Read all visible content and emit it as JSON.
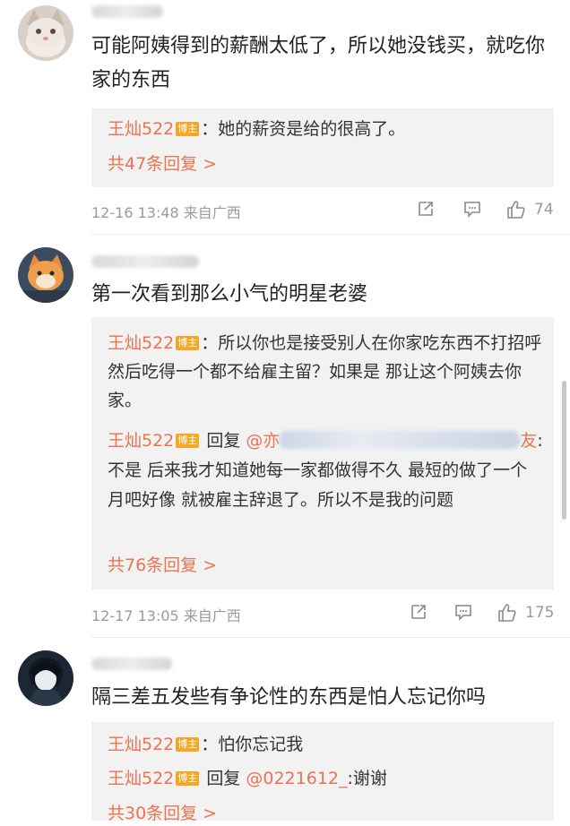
{
  "comments": [
    {
      "text": "可能阿姨得到的薪酬太低了，所以她没钱买，就吃你家的东西",
      "replies": [
        {
          "author": "王灿522",
          "badge": "博主",
          "sep": "：",
          "text": "她的薪资是给的很高了。"
        }
      ],
      "more": "共47条回复 >",
      "time": "12-16 13:48 来自广西",
      "likes": "74"
    },
    {
      "text": "第一次看到那么小气的明星老婆",
      "replies": [
        {
          "author": "王灿522",
          "badge": "博主",
          "sep": "：",
          "text": "所以你也是接受别人在你家吃东西不打招呼 然后吃得一个都不给雇主留？如果是 那让这个阿姨去你家。"
        },
        {
          "author": "王灿522",
          "badge": "博主",
          "reply_word": "回复",
          "mention_start": "@亦",
          "mention_end": "友",
          "text": ":不是 后来我才知道她每一家都做得不久 最短的做了一个月吧好像 就被雇主辞退了。所以不是我的问题"
        }
      ],
      "more": "共76条回复 >",
      "time": "12-17 13:05 来自广西",
      "likes": "175"
    },
    {
      "text": "隔三差五发些有争论性的东西是怕人忘记你吗",
      "replies": [
        {
          "author": "王灿522",
          "badge": "博主",
          "sep": "：",
          "text": "怕你忘记我"
        },
        {
          "author": "王灿522",
          "badge": "博主",
          "reply_word": "回复",
          "mention": "@0221612_",
          "text": ":谢谢"
        }
      ],
      "more": "共30条回复 >"
    }
  ],
  "colors": {
    "author": "#eb7350",
    "badge": "#f5a623",
    "reply_bg": "#f2f2f2",
    "meta": "#9a9a9a"
  }
}
